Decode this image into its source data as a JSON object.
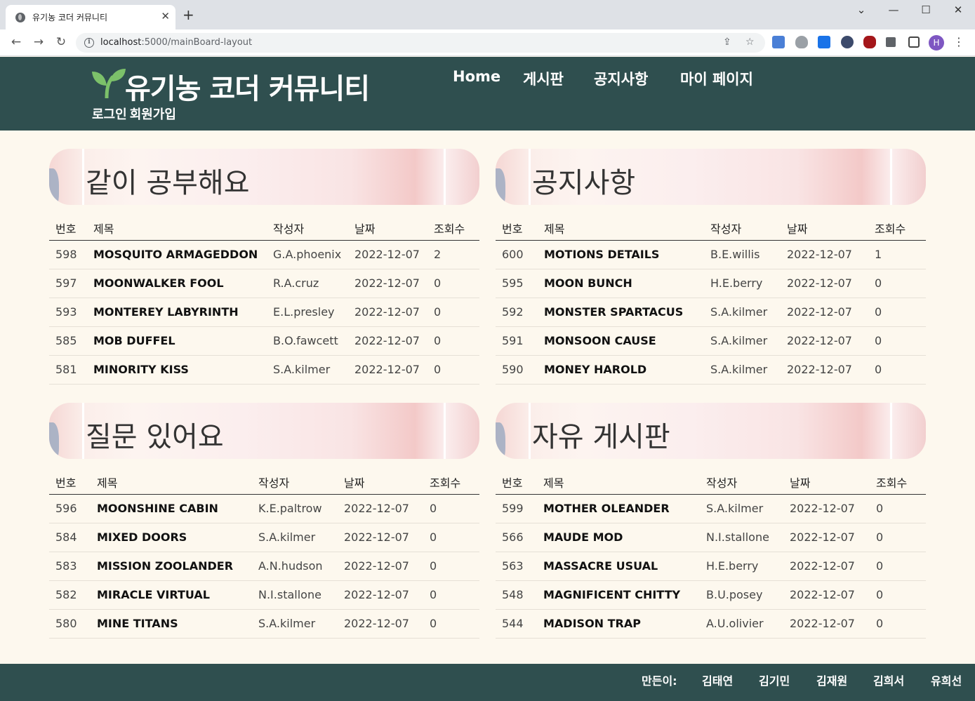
{
  "browser": {
    "tab_title": "유기농 코더 커뮤니티",
    "url_host": "localhost",
    "url_path": ":5000/mainBoard-layout",
    "profile_initial": "H"
  },
  "site": {
    "logo_text": "유기농 코더 커뮤니티",
    "login": "로그인",
    "signup": "회원가입",
    "nav": [
      "Home",
      "게시판",
      "공지사항",
      "마이 페이지"
    ]
  },
  "boards": [
    {
      "title": "같이 공부해요",
      "headers": [
        "번호",
        "제목",
        "작성자",
        "날짜",
        "조회수"
      ],
      "rows": [
        [
          "598",
          "MOSQUITO ARMAGEDDON",
          "G.A.phoenix",
          "2022-12-07",
          "2"
        ],
        [
          "597",
          "MOONWALKER FOOL",
          "R.A.cruz",
          "2022-12-07",
          "0"
        ],
        [
          "593",
          "MONTEREY LABYRINTH",
          "E.L.presley",
          "2022-12-07",
          "0"
        ],
        [
          "585",
          "MOB DUFFEL",
          "B.O.fawcett",
          "2022-12-07",
          "0"
        ],
        [
          "581",
          "MINORITY KISS",
          "S.A.kilmer",
          "2022-12-07",
          "0"
        ]
      ]
    },
    {
      "title": "공지사항",
      "headers": [
        "번호",
        "제목",
        "작성자",
        "날짜",
        "조회수"
      ],
      "rows": [
        [
          "600",
          "MOTIONS DETAILS",
          "B.E.willis",
          "2022-12-07",
          "1"
        ],
        [
          "595",
          "MOON BUNCH",
          "H.E.berry",
          "2022-12-07",
          "0"
        ],
        [
          "592",
          "MONSTER SPARTACUS",
          "S.A.kilmer",
          "2022-12-07",
          "0"
        ],
        [
          "591",
          "MONSOON CAUSE",
          "S.A.kilmer",
          "2022-12-07",
          "0"
        ],
        [
          "590",
          "MONEY HAROLD",
          "S.A.kilmer",
          "2022-12-07",
          "0"
        ]
      ]
    },
    {
      "title": "질문 있어요",
      "headers": [
        "번호",
        "제목",
        "작성자",
        "날짜",
        "조회수"
      ],
      "rows": [
        [
          "596",
          "MOONSHINE CABIN",
          "K.E.paltrow",
          "2022-12-07",
          "0"
        ],
        [
          "584",
          "MIXED DOORS",
          "S.A.kilmer",
          "2022-12-07",
          "0"
        ],
        [
          "583",
          "MISSION ZOOLANDER",
          "A.N.hudson",
          "2022-12-07",
          "0"
        ],
        [
          "582",
          "MIRACLE VIRTUAL",
          "N.I.stallone",
          "2022-12-07",
          "0"
        ],
        [
          "580",
          "MINE TITANS",
          "S.A.kilmer",
          "2022-12-07",
          "0"
        ]
      ]
    },
    {
      "title": "자유 게시판",
      "headers": [
        "번호",
        "제목",
        "작성자",
        "날짜",
        "조회수"
      ],
      "rows": [
        [
          "599",
          "MOTHER OLEANDER",
          "S.A.kilmer",
          "2022-12-07",
          "0"
        ],
        [
          "566",
          "MAUDE MOD",
          "N.I.stallone",
          "2022-12-07",
          "0"
        ],
        [
          "563",
          "MASSACRE USUAL",
          "H.E.berry",
          "2022-12-07",
          "0"
        ],
        [
          "548",
          "MAGNIFICENT CHITTY",
          "B.U.posey",
          "2022-12-07",
          "0"
        ],
        [
          "544",
          "MADISON TRAP",
          "A.U.olivier",
          "2022-12-07",
          "0"
        ]
      ]
    }
  ],
  "footer": {
    "label": "만든이:",
    "members": [
      "김태연",
      "김기민",
      "김재원",
      "김희서",
      "유희선"
    ]
  },
  "colors": {
    "header_bg": "#2f4f4f",
    "page_bg": "#fdf8ee",
    "leaf": "#7cc16a"
  }
}
